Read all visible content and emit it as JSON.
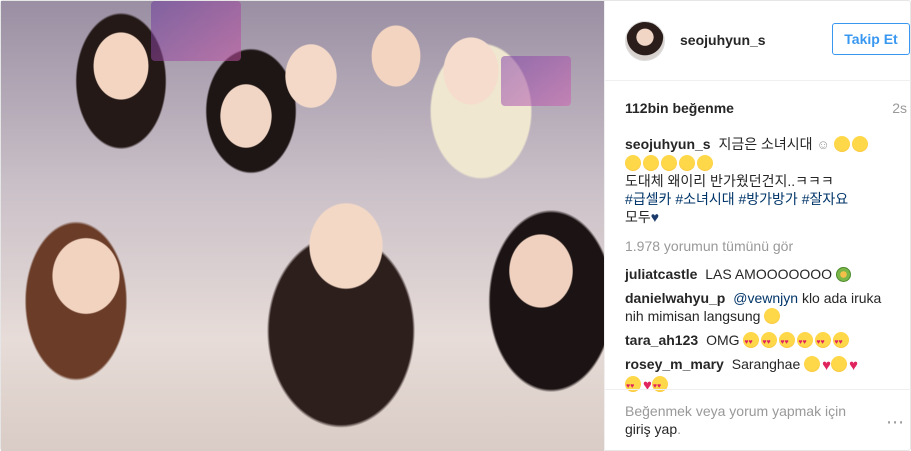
{
  "header": {
    "username": "seojuhyun_s",
    "follow_label": "Takip Et"
  },
  "stats": {
    "likes": "112bin beğenme",
    "time": "2s"
  },
  "caption": {
    "username": "seojuhyun_s",
    "text_line1": "지금은 소녀시대",
    "text_line2": "도대체 왜이리 반가웠던건지..ㅋㅋㅋ",
    "hashtags": "#급셀카 #소녀시대 #방가방가 #잘자요",
    "text_line3": "모두"
  },
  "view_all": "1.978 yorumun tümünü gör",
  "comments": [
    {
      "username": "juliatcastle",
      "text": "LAS AMOOOOOOO"
    },
    {
      "username": "danielwahyu_p",
      "mention": "@vewnjyn",
      "text": "klo ada iruka nih mimisan langsung"
    },
    {
      "username": "tara_ah123",
      "text": "OMG"
    },
    {
      "username": "rosey_m_mary",
      "text": "Saranghae"
    }
  ],
  "footer": {
    "login_prefix": "Beğenmek veya yorum yapmak için",
    "login_link": "giriş yap",
    "login_suffix": ".",
    "more_label": "⋯"
  },
  "icons": {
    "emoji": "smiley-emoji",
    "heart": "heart-emoji",
    "more": "more-options-icon"
  },
  "colors": {
    "follow": "#3897f0",
    "hashtag": "#003569",
    "muted": "#999999"
  }
}
